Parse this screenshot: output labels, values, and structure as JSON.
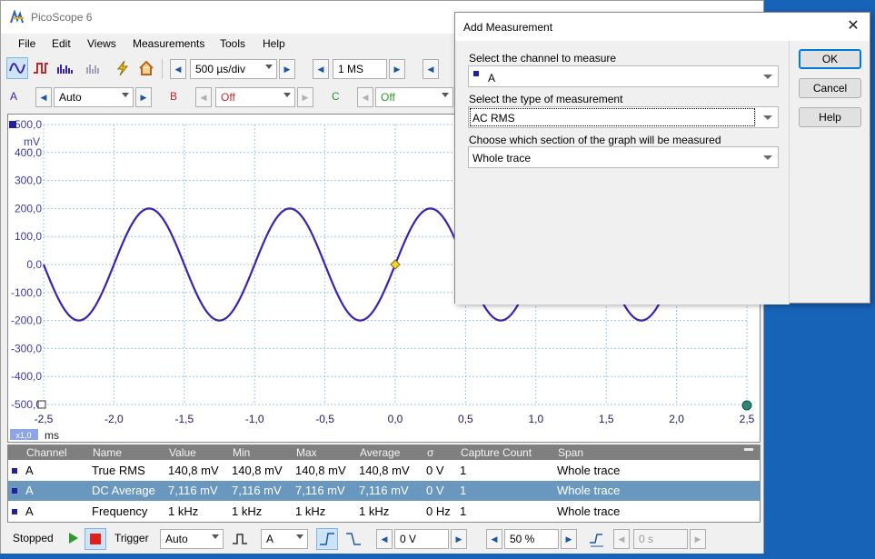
{
  "app": {
    "title": "PicoScope 6"
  },
  "menu": [
    "File",
    "Edit",
    "Views",
    "Measurements",
    "Tools",
    "Help"
  ],
  "toolbar": {
    "timebase": "500 µs/div",
    "samples": "1 MS",
    "channel_a": {
      "letter": "A",
      "range": "Auto"
    },
    "channel_b": {
      "letter": "B",
      "range": "Off"
    },
    "channel_c": {
      "letter": "C",
      "range": "Off"
    }
  },
  "graph": {
    "y_unit": "mV",
    "x_unit": "ms",
    "zoom_badge": "x1,0",
    "y_ticks": [
      "500,0",
      "400,0",
      "300,0",
      "200,0",
      "100,0",
      "0,0",
      "-100,0",
      "-200,0",
      "-300,0",
      "-400,0",
      "-500,0"
    ],
    "x_ticks": [
      "-2,5",
      "-2,0",
      "-1,5",
      "-1,0",
      "-0,5",
      "0,0",
      "0,5",
      "1,0",
      "1,5",
      "2,0",
      "2,5"
    ],
    "trace_color": "#3b22b0"
  },
  "chart_data": {
    "type": "line",
    "series": [
      {
        "name": "A",
        "amplitude": 200,
        "frequency_khz": 1,
        "phase_at_zero": 0,
        "color": "#3b22b0"
      }
    ],
    "xlim": [
      -2.5,
      2.5
    ],
    "ylim": [
      -500,
      500
    ],
    "xlabel": "ms",
    "ylabel": "mV"
  },
  "measurements": {
    "columns": [
      "Channel",
      "Name",
      "Value",
      "Min",
      "Max",
      "Average",
      "σ",
      "Capture Count",
      "Span"
    ],
    "rows": [
      {
        "channel": "A",
        "name": "True RMS",
        "value": "140,8 mV",
        "min": "140,8 mV",
        "max": "140,8 mV",
        "average": "140,8 mV",
        "sigma": "0 V",
        "count": "1",
        "span": "Whole trace"
      },
      {
        "channel": "A",
        "name": "DC Average",
        "value": "7,116 mV",
        "min": "7,116 mV",
        "max": "7,116 mV",
        "average": "7,116 mV",
        "sigma": "0 V",
        "count": "1",
        "span": "Whole trace"
      },
      {
        "channel": "A",
        "name": "Frequency",
        "value": "1 kHz",
        "min": "1 kHz",
        "max": "1 kHz",
        "average": "1 kHz",
        "sigma": "0 Hz",
        "count": "1",
        "span": "Whole trace"
      }
    ]
  },
  "bottom": {
    "status": "Stopped",
    "trigger_label": "Trigger",
    "trigger_mode": "Auto",
    "trigger_channel": "A",
    "threshold": "0 V",
    "pre_trigger": "50 %",
    "delay": "0 s"
  },
  "dialog": {
    "title": "Add Measurement",
    "close": "✕",
    "label_channel": "Select the channel to measure",
    "channel_value": "A",
    "label_type": "Select the type of measurement",
    "type_value": "AC RMS",
    "label_section": "Choose which section of the graph will be measured",
    "section_value": "Whole trace",
    "ok": "OK",
    "cancel": "Cancel",
    "help": "Help"
  }
}
